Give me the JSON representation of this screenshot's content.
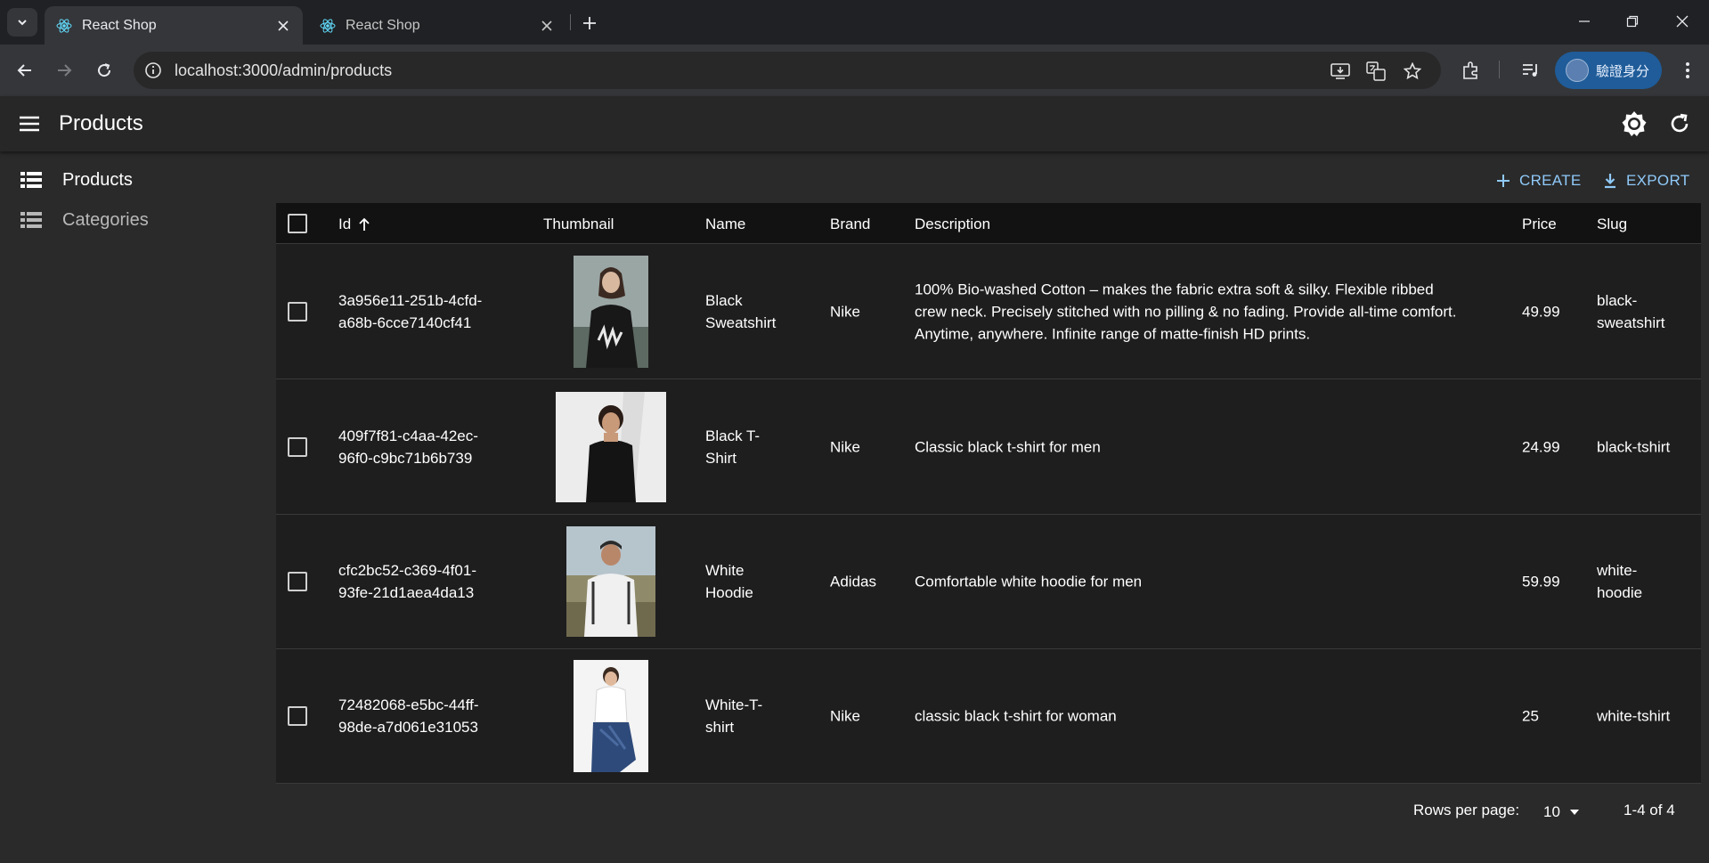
{
  "browser": {
    "tabs": [
      {
        "title": "React Shop",
        "active": true
      },
      {
        "title": "React Shop",
        "active": false
      }
    ],
    "url": "localhost:3000/admin/products",
    "profile_label": "驗證身分"
  },
  "appbar": {
    "title": "Products"
  },
  "sidebar": {
    "items": [
      {
        "label": "Products",
        "active": true
      },
      {
        "label": "Categories",
        "active": false
      }
    ]
  },
  "actions": {
    "create_label": "CREATE",
    "export_label": "EXPORT"
  },
  "table": {
    "columns": [
      "Id",
      "Thumbnail",
      "Name",
      "Brand",
      "Description",
      "Price",
      "Slug"
    ],
    "sort_column": "Id",
    "sort_direction": "ascending",
    "rows": [
      {
        "id": "3a956e11-251b-4cfd-a68b-6cce7140cf41",
        "id_lines": [
          "3a956e11-251b-4cfd-",
          "a68b-6cce7140cf41"
        ],
        "name_lines": [
          "Black",
          "Sweatshirt"
        ],
        "brand": "Nike",
        "description_lines": [
          "100% Bio-washed Cotton – makes the fabric extra soft & silky. Flexible ribbed",
          "crew neck. Precisely stitched with no pilling & no fading. Provide all-time comfort.",
          "Anytime, anywhere. Infinite range of matte-finish HD prints."
        ],
        "price": "49.99",
        "slug_lines": [
          "black-",
          "sweatshirt"
        ]
      },
      {
        "id": "409f7f81-c4aa-42ec-96f0-c9bc71b6b739",
        "id_lines": [
          "409f7f81-c4aa-42ec-",
          "96f0-c9bc71b6b739"
        ],
        "name_lines": [
          "Black T-",
          "Shirt"
        ],
        "brand": "Nike",
        "description_lines": [
          "Classic black t-shirt for men"
        ],
        "price": "24.99",
        "slug_lines": [
          "black-tshirt"
        ]
      },
      {
        "id": "cfc2bc52-c369-4f01-93fe-21d1aea4da13",
        "id_lines": [
          "cfc2bc52-c369-4f01-",
          "93fe-21d1aea4da13"
        ],
        "name_lines": [
          "White",
          "Hoodie"
        ],
        "brand": "Adidas",
        "description_lines": [
          "Comfortable white hoodie for men"
        ],
        "price": "59.99",
        "slug_lines": [
          "white-",
          "hoodie"
        ]
      },
      {
        "id": "72482068-e5bc-44ff-98de-a7d061e31053",
        "id_lines": [
          "72482068-e5bc-44ff-",
          "98de-a7d061e31053"
        ],
        "name_lines": [
          "White-T-",
          "shirt"
        ],
        "brand": "Nike",
        "description_lines": [
          "classic black t-shirt for woman"
        ],
        "price": "25",
        "slug_lines": [
          "white-tshirt"
        ]
      }
    ]
  },
  "pagination": {
    "rows_per_page_label": "Rows per page:",
    "rows_per_page_value": "10",
    "range_label": "1-4 of 4"
  },
  "colors": {
    "accent": "#90caf9",
    "background": "#2a2a2a",
    "table_background": "#1e1e1e",
    "profile_pill": "#1f5c99"
  }
}
